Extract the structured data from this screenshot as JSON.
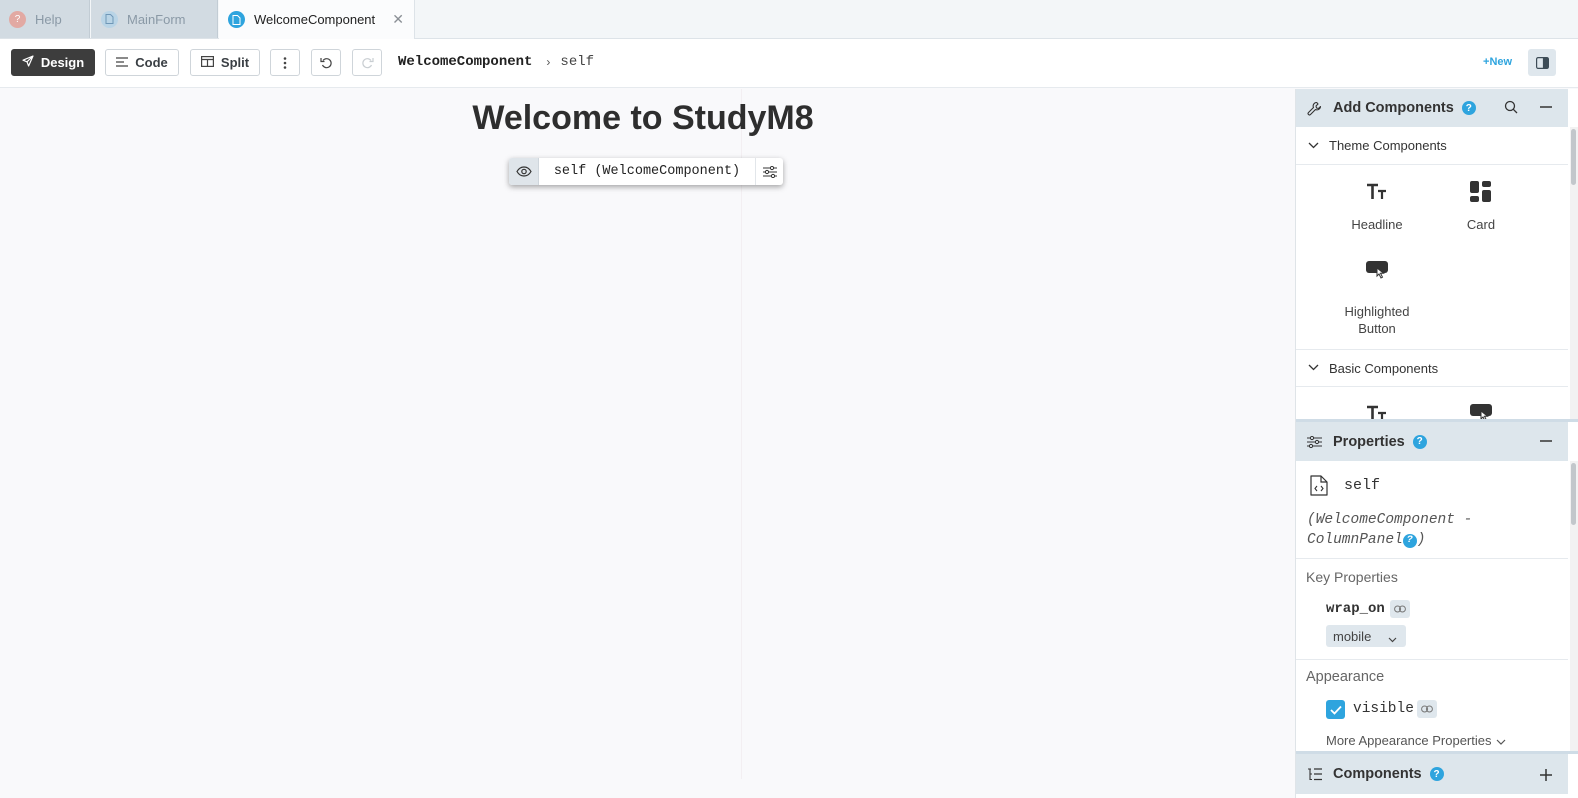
{
  "tabs": [
    {
      "label": "Help",
      "icon": "help-icon"
    },
    {
      "label": "MainForm",
      "icon": "file-icon"
    },
    {
      "label": "WelcomeComponent",
      "icon": "file-icon",
      "active": true
    }
  ],
  "toolbar": {
    "design_label": "Design",
    "code_label": "Code",
    "split_label": "Split",
    "breadcrumb_component": "WelcomeComponent",
    "breadcrumb_item": "self",
    "new_label": "New"
  },
  "canvas": {
    "headline": "Welcome to StudyM8",
    "selection_label": "self (WelcomeComponent)"
  },
  "add_components": {
    "title": "Add Components",
    "theme_section": "Theme Components",
    "theme_items": [
      "Headline",
      "Card",
      "Highlighted Button"
    ],
    "basic_section": "Basic Components"
  },
  "properties": {
    "title": "Properties",
    "component_name": "self",
    "component_type_line1": "(WelcomeComponent -",
    "component_type_line2": "ColumnPanel",
    "component_type_close": ")",
    "key_properties_label": "Key Properties",
    "wrap_on_label": "wrap_on",
    "wrap_on_value": "mobile",
    "appearance_label": "Appearance",
    "visible_label": "visible",
    "visible_checked": true,
    "more_appearance_label": "More Appearance Properties"
  },
  "components_panel": {
    "title": "Components"
  },
  "colors": {
    "accent": "#2ea4de",
    "design_button": "#3d3d3d",
    "panel_header": "#dde6ec"
  }
}
